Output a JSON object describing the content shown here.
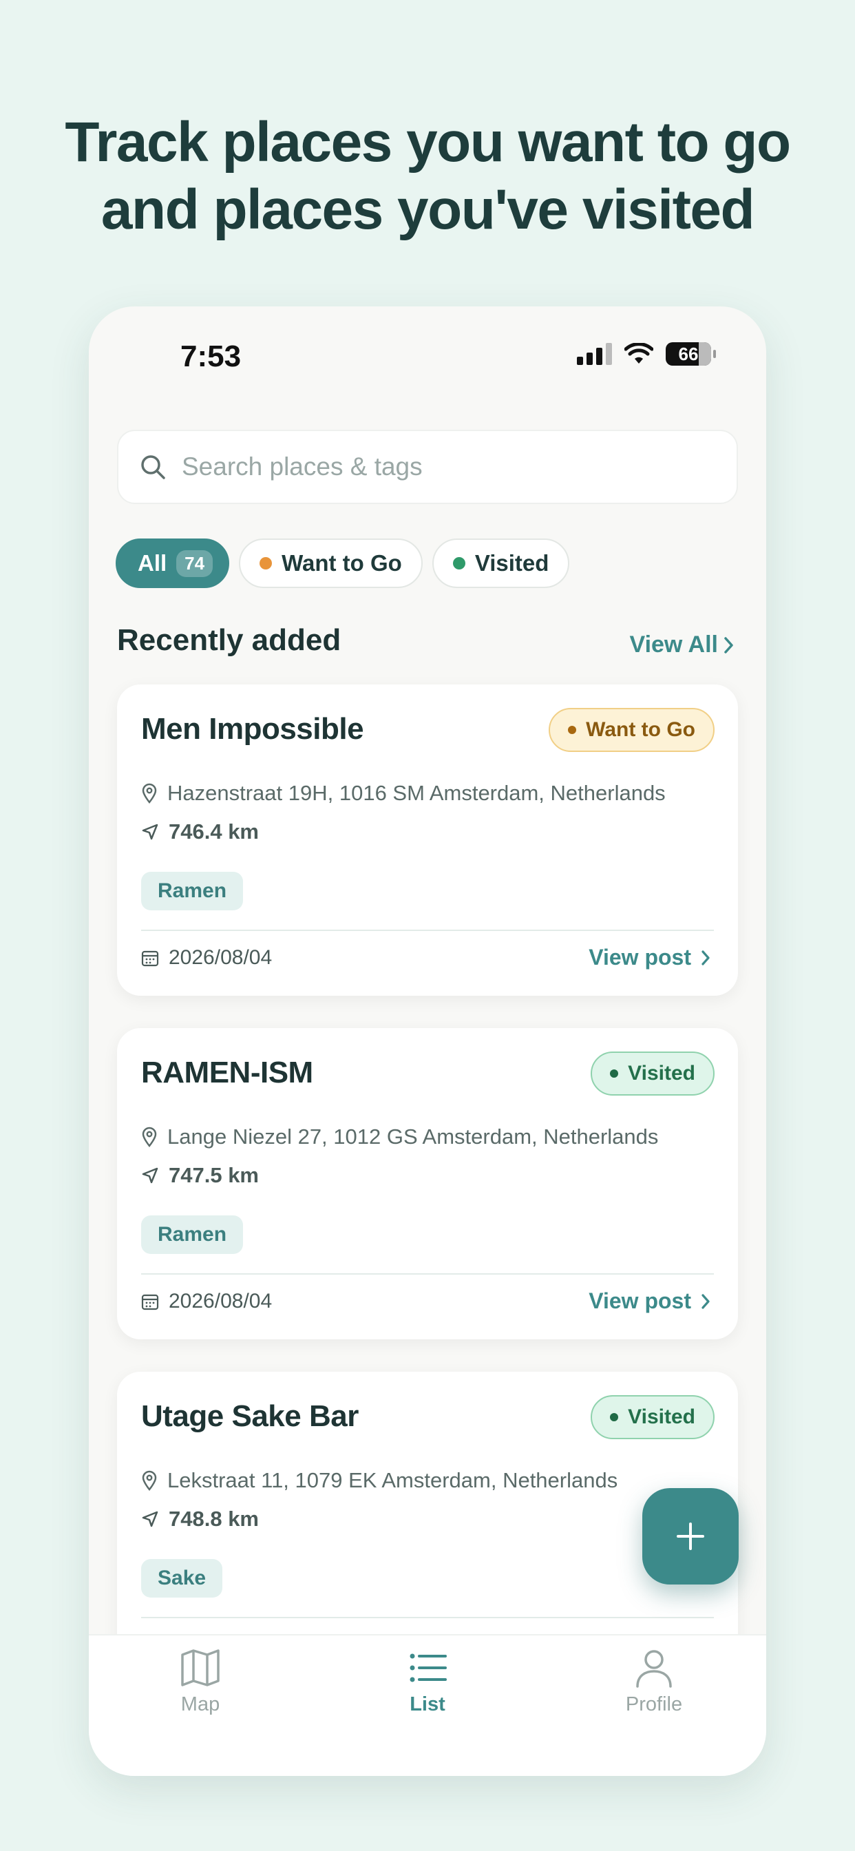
{
  "headline": {
    "line1": "Track places you want to go",
    "line2": "and places you've visited"
  },
  "status_bar": {
    "time": "7:53",
    "battery": "66"
  },
  "search": {
    "placeholder": "Search places & tags"
  },
  "filters": [
    {
      "label": "All",
      "count": "74",
      "active": true
    },
    {
      "label": "Want to Go",
      "dot_color": "#e8943a"
    },
    {
      "label": "Visited",
      "dot_color": "#2f9a6a"
    }
  ],
  "section": {
    "title": "Recently added",
    "view_all": "View All"
  },
  "places": [
    {
      "name": "Men Impossible",
      "status": "Want to Go",
      "address": "Hazenstraat 19H, 1016 SM Amsterdam, Netherlands",
      "distance": "746.4 km",
      "tag": "Ramen",
      "date": "2026/08/04",
      "action": "View post"
    },
    {
      "name": "RAMEN-ISM",
      "status": "Visited",
      "address": "Lange Niezel 27, 1012 GS Amsterdam, Netherlands",
      "distance": "747.5 km",
      "tag": "Ramen",
      "date": "2026/08/04",
      "action": "View post"
    },
    {
      "name": "Utage Sake Bar",
      "status": "Visited",
      "address": "Lekstraat 11, 1079 EK Amsterdam, Netherlands",
      "distance": "748.8 km",
      "tag": "Sake"
    }
  ],
  "tabs": [
    {
      "label": "Map",
      "icon": "map-icon"
    },
    {
      "label": "List",
      "icon": "list-icon",
      "active": true
    },
    {
      "label": "Profile",
      "icon": "profile-icon"
    }
  ],
  "colors": {
    "accent": "#3c8a8a",
    "background": "#e9f5f1",
    "want_to_go": "#e8943a",
    "visited": "#2f9a6a"
  }
}
